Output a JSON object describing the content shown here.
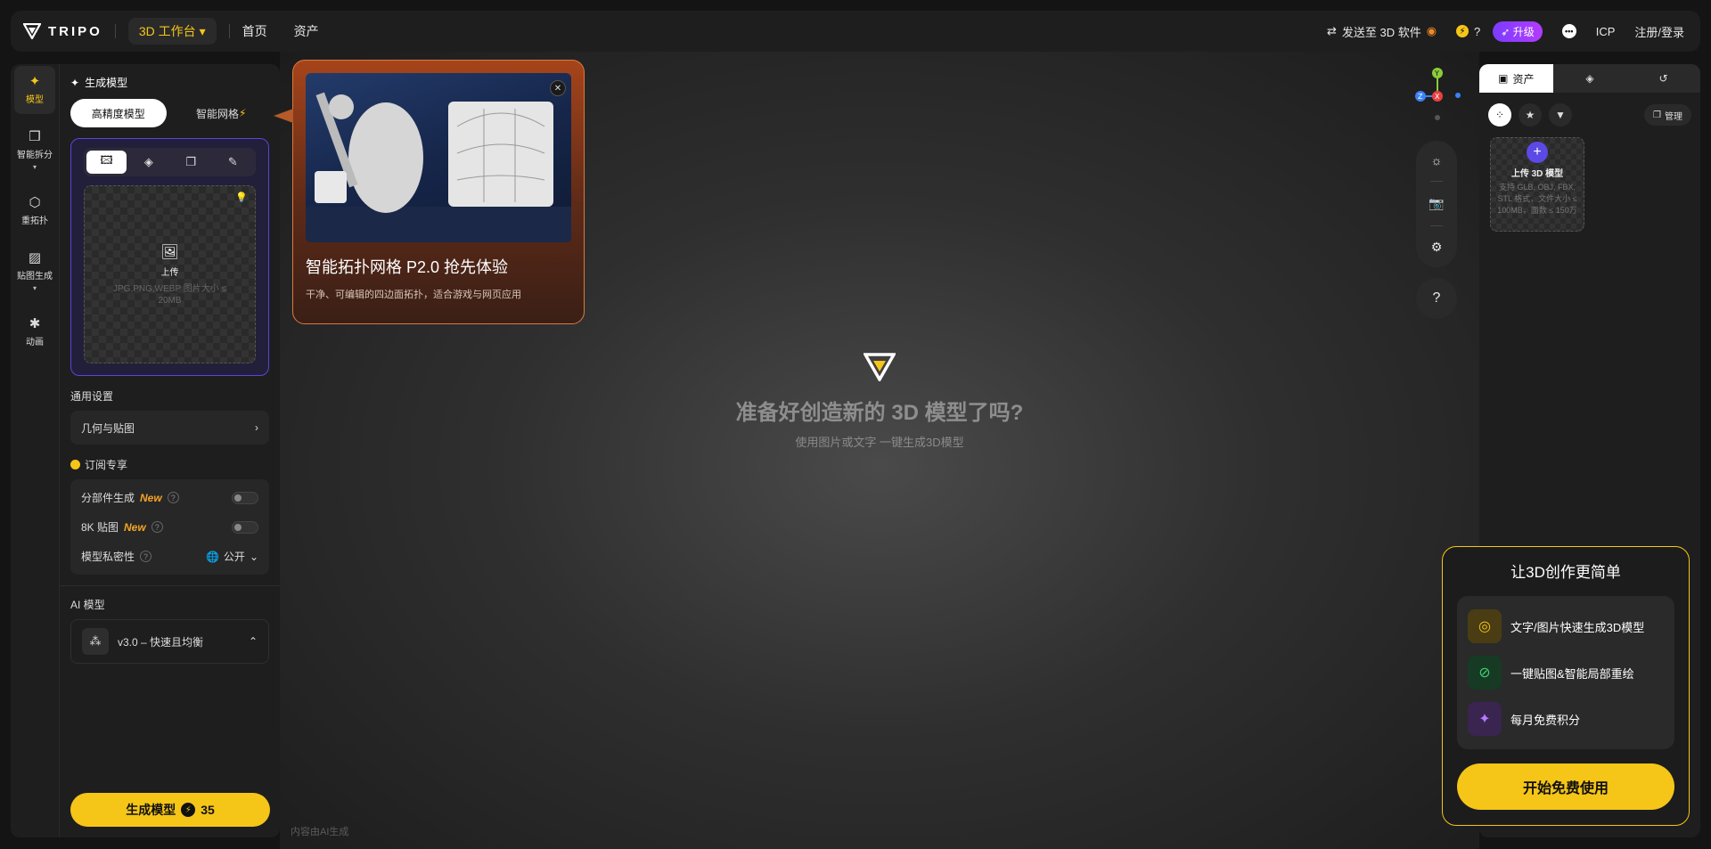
{
  "brand": {
    "name": "TRIPO"
  },
  "topbar": {
    "workbench_label": "3D 工作台",
    "nav": [
      "首页",
      "资产"
    ],
    "send_to_3d": "发送至 3D 软件",
    "credits": "?",
    "upgrade": "升级",
    "icp": "ICP",
    "login": "注册/登录"
  },
  "rail": [
    {
      "label": "模型",
      "icon": "✦",
      "active": true
    },
    {
      "label": "智能拆分",
      "icon": "❒",
      "caret": "▾"
    },
    {
      "label": "重拓扑",
      "icon": "⬡"
    },
    {
      "label": "贴图生成",
      "icon": "▨",
      "caret": "▾"
    },
    {
      "label": "动画",
      "icon": "✱"
    }
  ],
  "panel": {
    "title": "生成模型",
    "segments": [
      "高精度模型",
      "智能网格"
    ],
    "upload_label": "上传",
    "upload_hint": "JPG,PNG,WEBP 图片大小 ≤ 20MB",
    "general_settings": "通用设置",
    "geometry_texture": "几何与贴图",
    "subscription": "订阅专享",
    "options": [
      {
        "label": "分部件生成",
        "tag": "New"
      },
      {
        "label": "8K 贴图",
        "tag": "New"
      },
      {
        "label": "模型私密性",
        "value": "公开"
      }
    ],
    "ai_model_label": "AI 模型",
    "ai_model_value": "v3.0 – 快速且均衡",
    "generate_button": "生成模型",
    "generate_cost": "35"
  },
  "promo": {
    "title": "智能拓扑网格 P2.0 抢先体验",
    "desc": "干净、可编辑的四边面拓扑，适合游戏与网页应用"
  },
  "canvas": {
    "title": "准备好创造新的 3D 模型了吗?",
    "subtitle": "使用图片或文字 一键生成3D模型",
    "ai_note": "内容由AI生成"
  },
  "gizmo": {
    "y": "Y",
    "x": "X",
    "z": "Z"
  },
  "assets": {
    "tab_assets": "资产",
    "manage": "管理",
    "upload_label": "上传 3D 模型",
    "upload_hint": "支持 GLB, OBJ, FBX, STL 格式，文件大小 ≤ 100MB，面数 ≤ 150万"
  },
  "signup_card": {
    "title": "让3D创作更简单",
    "items": [
      "文字/图片快速生成3D模型",
      "一键贴图&智能局部重绘",
      "每月免费积分"
    ],
    "cta": "开始免费使用"
  },
  "colors": {
    "accent": "#f5c518",
    "purple": "#5b4ae6",
    "bg": "#141414"
  }
}
